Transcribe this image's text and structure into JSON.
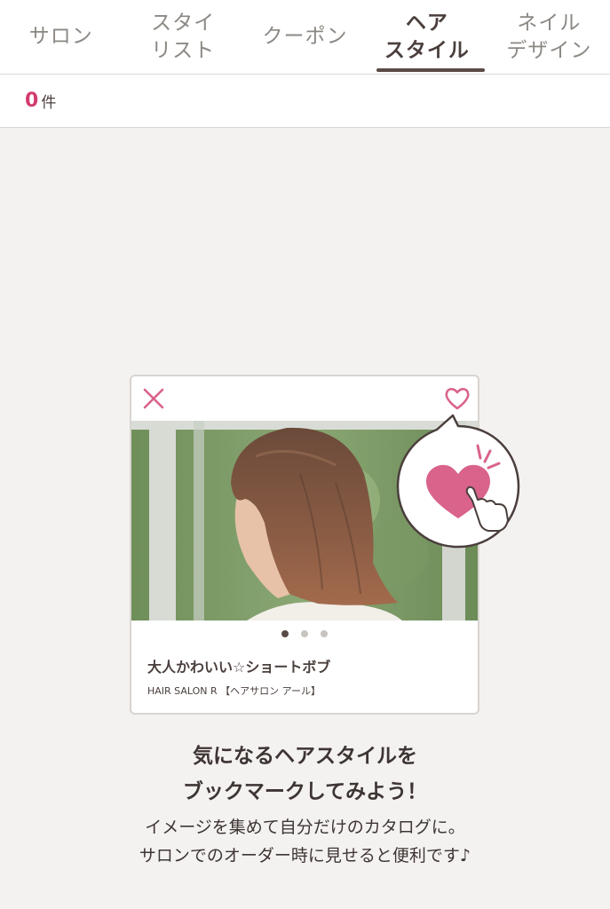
{
  "tabs": [
    {
      "label": "サロン",
      "active": false
    },
    {
      "label": "スタイ\nリスト",
      "active": false
    },
    {
      "label": "クーポン",
      "active": false
    },
    {
      "label": "ヘア\nスタイル",
      "active": true
    },
    {
      "label": "ネイル\nデザイン",
      "active": false
    }
  ],
  "count": {
    "value": "0",
    "unit": "件"
  },
  "card": {
    "title": "大人かわいい☆ショートボブ",
    "salon": "HAIR SALON R 【ヘアサロン アール】",
    "dots_total": 3,
    "dot_active": 0
  },
  "headline": {
    "line1": "気になるヘアスタイルを",
    "line2": "ブックマークしてみよう！"
  },
  "subline": {
    "line1": "イメージを集めて自分だけのカタログに。",
    "line2": "サロンでのオーダー時に見せると便利です♪"
  },
  "colors": {
    "accent": "#d23c6e",
    "heart": "#d9638a",
    "text_dark": "#4a3f3c"
  }
}
